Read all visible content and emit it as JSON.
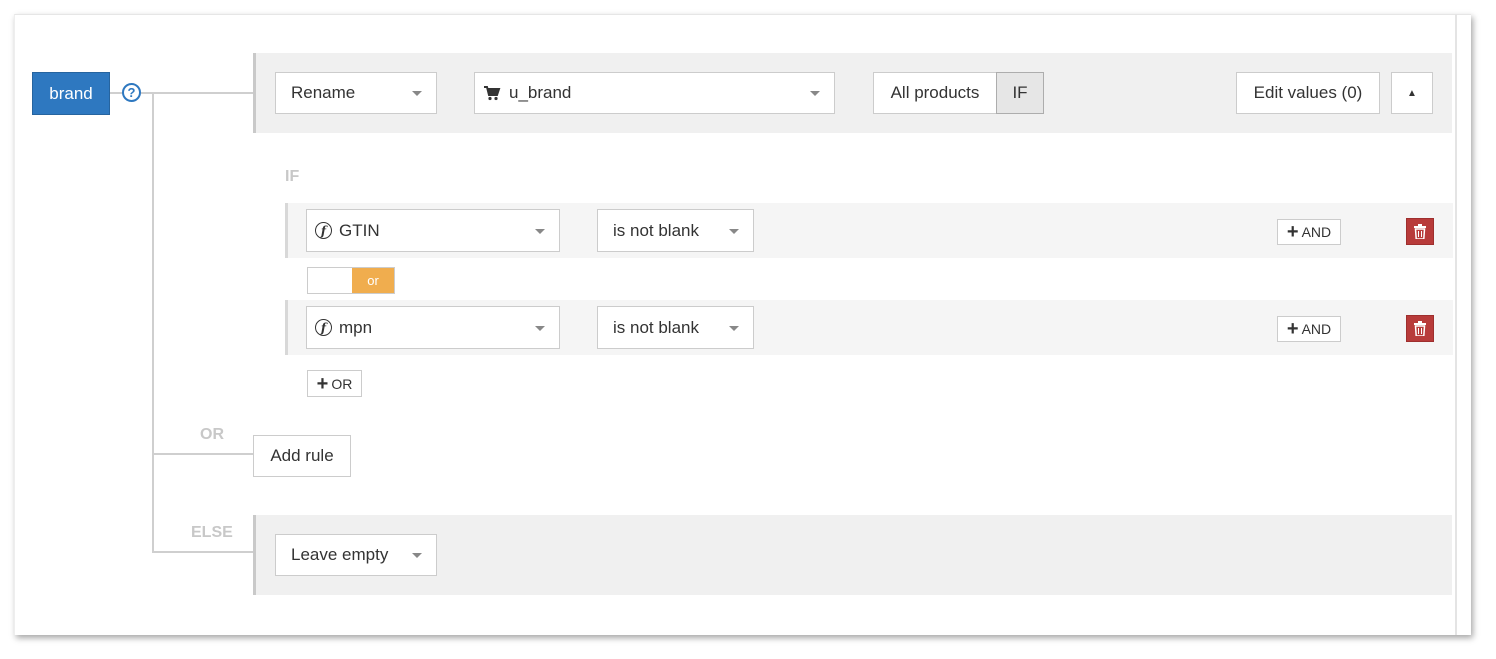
{
  "field": {
    "name": "brand",
    "help_glyph": "?"
  },
  "rule": {
    "action_select": "Rename",
    "source_select": "u_brand",
    "scope_all_label": "All products",
    "scope_if_label": "IF",
    "edit_values_label": "Edit values (0)",
    "collapse_glyph": "▲"
  },
  "condition_block": {
    "if_label": "IF",
    "conditions": [
      {
        "field": "GTIN",
        "operator": "is not blank",
        "and_label": "AND"
      },
      {
        "field": "mpn",
        "operator": "is not blank",
        "and_label": "AND"
      }
    ],
    "or_toggle_label": "or",
    "add_or_label": "OR"
  },
  "or_label": "OR",
  "add_rule_label": "Add rule",
  "else_label": "ELSE",
  "else_select": "Leave empty",
  "colors": {
    "accent": "#2e78c0",
    "orange": "#f0ad4e",
    "danger": "#b83b3a"
  },
  "icons": {
    "source": "cart-icon",
    "function": "function-icon",
    "delete": "trash-icon"
  }
}
